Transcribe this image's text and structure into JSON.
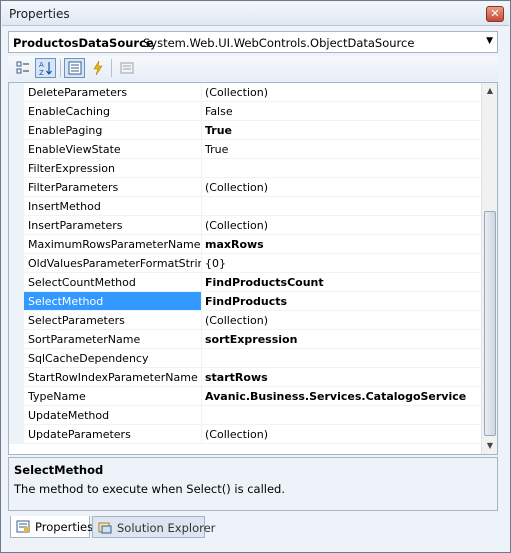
{
  "window": {
    "title": "Properties"
  },
  "object_selector": {
    "name": "ProductosDataSource",
    "type": "System.Web.UI.WebControls.ObjectDataSource"
  },
  "toolbar": {
    "buttons": [
      "categorized-icon",
      "alphabetical-icon",
      "properties-icon",
      "events-icon",
      "property-pages-icon"
    ]
  },
  "grid": {
    "rows": [
      {
        "name": "DeleteParameters",
        "value": "(Collection)",
        "bold": false
      },
      {
        "name": "EnableCaching",
        "value": "False",
        "bold": false
      },
      {
        "name": "EnablePaging",
        "value": "True",
        "bold": true
      },
      {
        "name": "EnableViewState",
        "value": "True",
        "bold": false
      },
      {
        "name": "FilterExpression",
        "value": "",
        "bold": false
      },
      {
        "name": "FilterParameters",
        "value": "(Collection)",
        "bold": false
      },
      {
        "name": "InsertMethod",
        "value": "",
        "bold": false
      },
      {
        "name": "InsertParameters",
        "value": "(Collection)",
        "bold": false
      },
      {
        "name": "MaximumRowsParameterName",
        "value": "maxRows",
        "bold": true
      },
      {
        "name": "OldValuesParameterFormatString",
        "value": "{0}",
        "bold": false
      },
      {
        "name": "SelectCountMethod",
        "value": "FindProductsCount",
        "bold": true
      },
      {
        "name": "SelectMethod",
        "value": "FindProducts",
        "bold": true,
        "selected": true
      },
      {
        "name": "SelectParameters",
        "value": "(Collection)",
        "bold": false
      },
      {
        "name": "SortParameterName",
        "value": "sortExpression",
        "bold": true
      },
      {
        "name": "SqlCacheDependency",
        "value": "",
        "bold": false
      },
      {
        "name": "StartRowIndexParameterName",
        "value": "startRows",
        "bold": true
      },
      {
        "name": "TypeName",
        "value": "Avanic.Business.Services.CatalogoService",
        "bold": true
      },
      {
        "name": "UpdateMethod",
        "value": "",
        "bold": false
      },
      {
        "name": "UpdateParameters",
        "value": "(Collection)",
        "bold": false
      }
    ]
  },
  "description": {
    "title": "SelectMethod",
    "text": "The method to execute when Select() is called."
  },
  "tabs": [
    {
      "label": "Properties",
      "active": true
    },
    {
      "label": "Solution Explorer",
      "active": false
    }
  ],
  "colors": {
    "selection": "#3399ff",
    "chrome": "#eef3f9"
  }
}
